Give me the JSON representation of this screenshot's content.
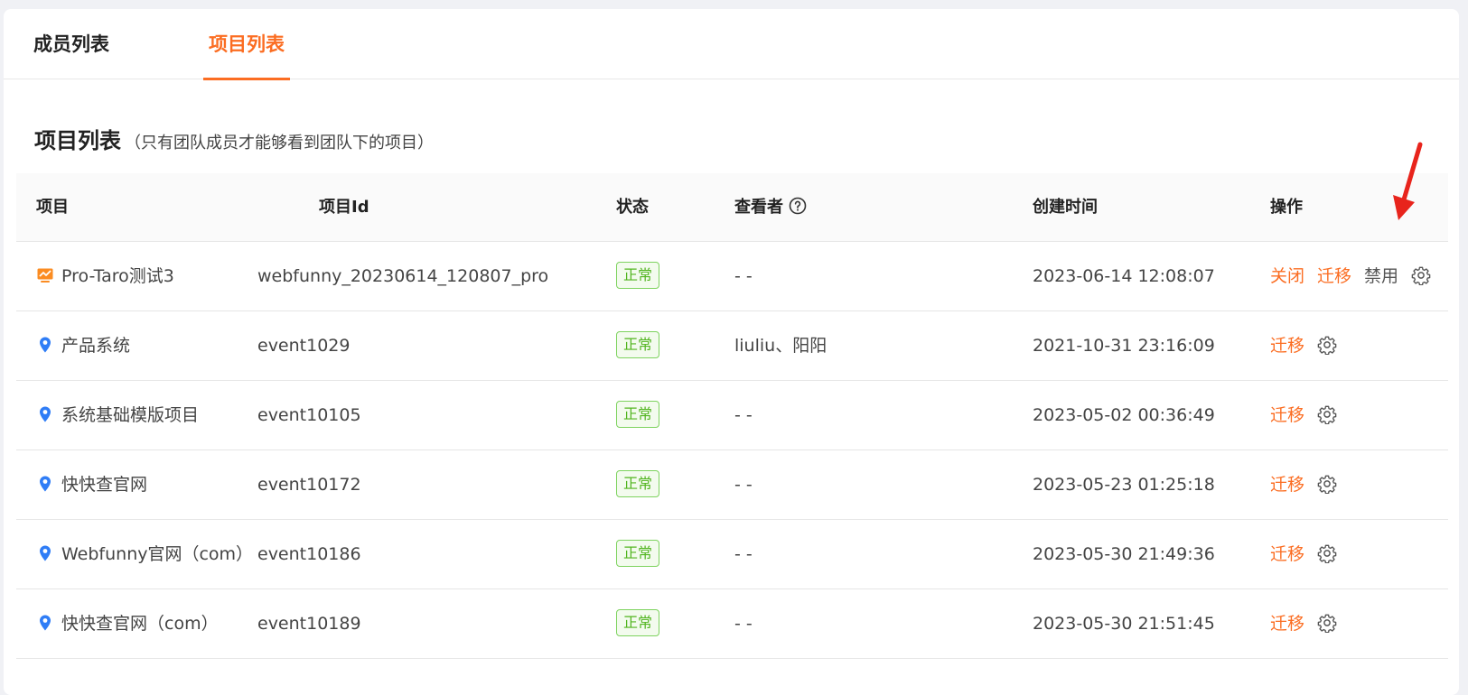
{
  "tabs": [
    {
      "label": "成员列表",
      "active": false
    },
    {
      "label": "项目列表",
      "active": true
    }
  ],
  "section": {
    "title": "项目列表",
    "note": "（只有团队成员才能够看到团队下的项目）"
  },
  "table": {
    "headers": {
      "name": "项目",
      "id": "项目Id",
      "status": "状态",
      "viewer": "查看者",
      "time": "创建时间",
      "ops": "操作"
    },
    "rows": [
      {
        "icon": "monitor-chart-icon",
        "name": "Pro-Taro测试3",
        "id": "webfunny_20230614_120807_pro",
        "status": "正常",
        "viewer": "- -",
        "time": "2023-06-14 12:08:07",
        "ops": [
          "关闭",
          "迁移",
          "禁用"
        ]
      },
      {
        "icon": "location-pin-icon",
        "name": "产品系统",
        "id": "event1029",
        "status": "正常",
        "viewer": "liuliu、阳阳",
        "time": "2021-10-31 23:16:09",
        "ops": [
          "迁移"
        ]
      },
      {
        "icon": "location-pin-icon",
        "name": "系统基础模版项目",
        "id": "event10105",
        "status": "正常",
        "viewer": "- -",
        "time": "2023-05-02 00:36:49",
        "ops": [
          "迁移"
        ]
      },
      {
        "icon": "location-pin-icon",
        "name": "快快查官网",
        "id": "event10172",
        "status": "正常",
        "viewer": "- -",
        "time": "2023-05-23 01:25:18",
        "ops": [
          "迁移"
        ]
      },
      {
        "icon": "location-pin-icon",
        "name": "Webfunny官网（com）",
        "id": "event10186",
        "status": "正常",
        "viewer": "- -",
        "time": "2023-05-30 21:49:36",
        "ops": [
          "迁移"
        ]
      },
      {
        "icon": "location-pin-icon",
        "name": "快快查官网（com）",
        "id": "event10189",
        "status": "正常",
        "viewer": "- -",
        "time": "2023-05-30 21:51:45",
        "ops": [
          "迁移"
        ]
      }
    ]
  },
  "colors": {
    "accent": "#fb6d22",
    "status_green": "#52b520",
    "pin_blue": "#2f7df6",
    "arrow_red": "#e8241c"
  }
}
